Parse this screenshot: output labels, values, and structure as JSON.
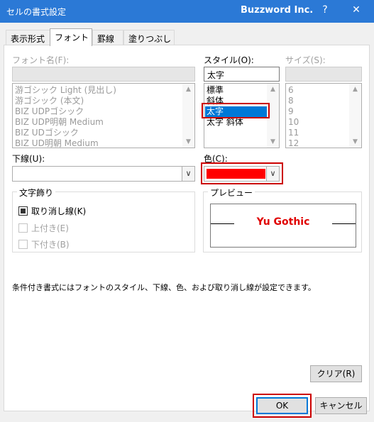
{
  "window": {
    "title": "セルの書式設定",
    "brand": "Buzzword Inc.",
    "help_label": "?",
    "close_label": "✕"
  },
  "tabs": [
    {
      "label": "表示形式"
    },
    {
      "label": "フォント"
    },
    {
      "label": "罫線"
    },
    {
      "label": "塗りつぶし"
    }
  ],
  "font": {
    "label": "フォント名(F):",
    "value": "",
    "items": [
      "游ゴシック Light (見出し)",
      "游ゴシック (本文)",
      "BIZ UDPゴシック",
      "BIZ UDP明朝 Medium",
      "BIZ UDゴシック",
      "BIZ UD明朝 Medium"
    ]
  },
  "style": {
    "label": "スタイル(O):",
    "value": "太字",
    "items": [
      "標準",
      "斜体",
      "太字",
      "太字 斜体"
    ],
    "selected": "太字"
  },
  "size": {
    "label": "サイズ(S):",
    "value": "",
    "items": [
      "6",
      "8",
      "9",
      "10",
      "11",
      "12"
    ]
  },
  "underline": {
    "label": "下線(U):",
    "value": ""
  },
  "color": {
    "label": "色(C):",
    "value_hex": "#ff0000"
  },
  "effects": {
    "title": "文字飾り",
    "strikethrough": "取り消し線(K)",
    "superscript": "上付き(E)",
    "subscript": "下付き(B)"
  },
  "preview": {
    "title": "プレビュー",
    "sample": "Yu Gothic",
    "sample_color": "#e00000"
  },
  "note": "条件付き書式にはフォントのスタイル、下線、色、および取り消し線が設定できます。",
  "buttons": {
    "clear": "クリア(R)",
    "ok": "OK",
    "cancel": "キャンセル"
  },
  "icons": {
    "scroll_up": "▲",
    "scroll_down": "▼",
    "dropdown": "∨"
  },
  "colors": {
    "titlebar": "#2b79d6",
    "selection": "#0078d7",
    "highlight": "#cc0000"
  }
}
